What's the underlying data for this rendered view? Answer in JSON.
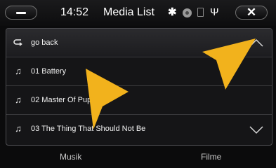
{
  "status_bar": {
    "minimize_label": "−",
    "time": "14:52",
    "title": "Media List",
    "close_label": "✕",
    "icons": [
      "bluetooth-icon",
      "disc-icon",
      "sd-card-icon",
      "usb-icon"
    ]
  },
  "media_list": {
    "items": [
      {
        "icon": "back-arrow-icon",
        "label": "go back"
      },
      {
        "icon": "music-note-icon",
        "label": "01 Battery"
      },
      {
        "icon": "music-note-icon",
        "label": "02 Master Of Puppets"
      },
      {
        "icon": "music-note-icon",
        "label": "03 The Thing That Should Not Be"
      }
    ],
    "scroll_up_icon": "chevron-up-icon",
    "scroll_down_icon": "chevron-down-icon",
    "scroll_position": 0.35
  },
  "tabs": [
    {
      "label": "Musik"
    },
    {
      "label": "Filme"
    }
  ],
  "colors": {
    "background": "#0b0b0c",
    "panel": "#151517",
    "pointer_arrow": "#f2b21c"
  }
}
